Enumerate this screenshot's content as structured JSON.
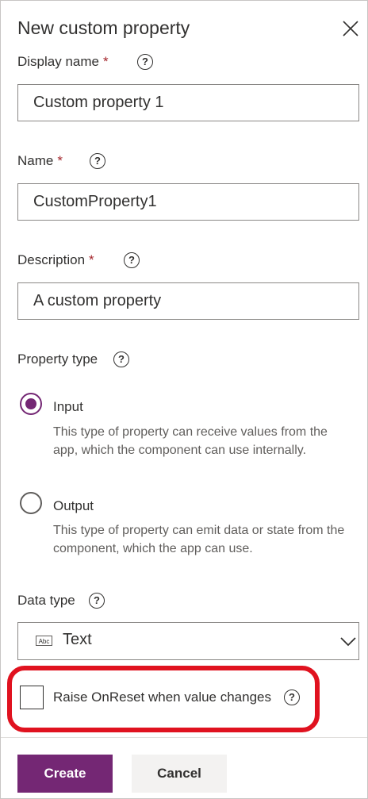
{
  "panel": {
    "title": "New custom property",
    "close_icon": "close-icon"
  },
  "fields": {
    "display_name": {
      "label": "Display name",
      "required": "*",
      "value": "Custom property 1"
    },
    "name": {
      "label": "Name",
      "required": "*",
      "value": "CustomProperty1"
    },
    "description": {
      "label": "Description",
      "required": "*",
      "value": "A custom property"
    }
  },
  "help_glyph": "?",
  "property_type": {
    "label": "Property type",
    "options": [
      {
        "label": "Input",
        "desc": "This type of property can receive values from the app, which the component can use internally.",
        "checked": true
      },
      {
        "label": "Output",
        "desc": "This type of property can emit data or state from the component, which the app can use.",
        "checked": false
      }
    ]
  },
  "data_type": {
    "label": "Data type",
    "icon_text": "Abc",
    "selected": "Text"
  },
  "raise_onreset": {
    "label": "Raise OnReset when value changes",
    "checked": false,
    "highlight_color": "#e0121f"
  },
  "buttons": {
    "create": "Create",
    "cancel": "Cancel"
  },
  "colors": {
    "accent": "#742774",
    "required": "#a4262c"
  }
}
